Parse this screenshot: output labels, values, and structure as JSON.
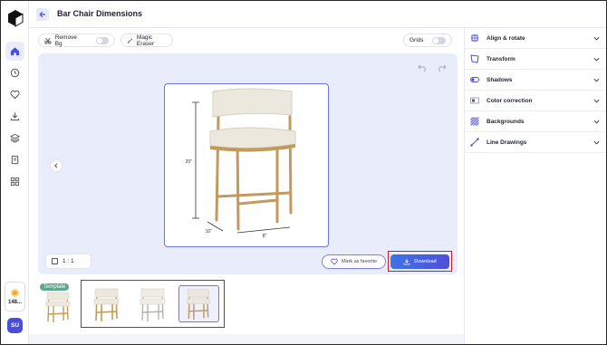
{
  "header": {
    "title": "Bar Chair Dimensions"
  },
  "toolbar": {
    "remove_bg_label": "Remove Bg",
    "magic_eraser_label": "Magic Eraser",
    "grids_label": "Grids"
  },
  "sidebar": {
    "items": [
      {
        "icon": "home-icon"
      },
      {
        "icon": "history-icon"
      },
      {
        "icon": "heart-icon"
      },
      {
        "icon": "download-icon"
      },
      {
        "icon": "layers-icon"
      },
      {
        "icon": "document-icon"
      },
      {
        "icon": "grid-icon"
      }
    ],
    "credits": "148...",
    "avatar_initials": "SU"
  },
  "canvas": {
    "dim_height": "20\"",
    "dim_depth": "10\"",
    "dim_width": "8\"",
    "aspect_ratio": "1 : 1",
    "favorite_label": "Mark as favorite",
    "download_label": "Download"
  },
  "thumbnails": {
    "template_tag": "Template"
  },
  "panel": {
    "items": [
      {
        "label": "Align & rotate",
        "icon": "align-rotate-icon"
      },
      {
        "label": "Transform",
        "icon": "transform-icon"
      },
      {
        "label": "Shadows",
        "icon": "shadows-icon"
      },
      {
        "label": "Color correction",
        "icon": "color-correction-icon"
      },
      {
        "label": "Backgrounds",
        "icon": "backgrounds-icon"
      },
      {
        "label": "Line Drawings",
        "icon": "line-drawings-icon"
      }
    ]
  },
  "colors": {
    "accent": "#4f4fd8",
    "canvas_bg": "#e9ecfb",
    "highlight": "#d6191c",
    "wood": "#c49a5c",
    "cushion": "#ece8dd"
  }
}
